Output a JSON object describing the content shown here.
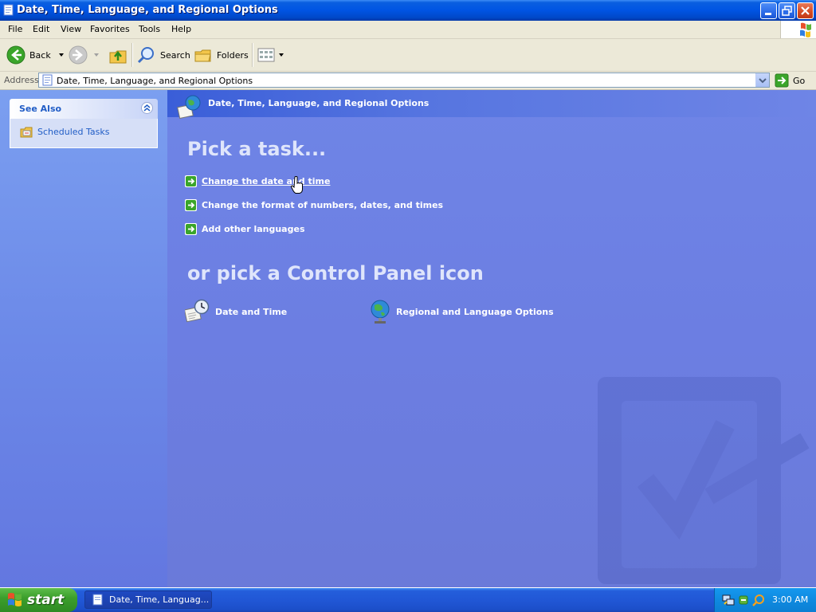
{
  "window": {
    "title": "Date, Time, Language, and Regional Options"
  },
  "menu": [
    "File",
    "Edit",
    "View",
    "Favorites",
    "Tools",
    "Help"
  ],
  "toolbar": {
    "back": "Back",
    "search": "Search",
    "folders": "Folders"
  },
  "address": {
    "label": "Address",
    "value": "Date, Time, Language, and Regional Options",
    "go": "Go"
  },
  "see_also": {
    "title": "See Also",
    "items": [
      {
        "label": "Scheduled Tasks"
      }
    ]
  },
  "main": {
    "header": "Date, Time, Language, and Regional Options",
    "pick_task": "Pick a task...",
    "tasks": [
      {
        "label": "Change the date and time"
      },
      {
        "label": "Change the format of numbers, dates, and times"
      },
      {
        "label": "Add other languages"
      }
    ],
    "or_pick": "or pick a Control Panel icon",
    "icons": [
      {
        "label": "Date and Time"
      },
      {
        "label": "Regional and Language Options"
      }
    ]
  },
  "taskbar": {
    "start": "start",
    "window_button": "Date, Time, Languag...",
    "clock": "3:00 AM"
  },
  "colors": {
    "title_blue": "#0054e3",
    "pane_blue": "#6c7ee2",
    "link_blue": "#215dc6",
    "start_green": "#3c9f2c"
  }
}
